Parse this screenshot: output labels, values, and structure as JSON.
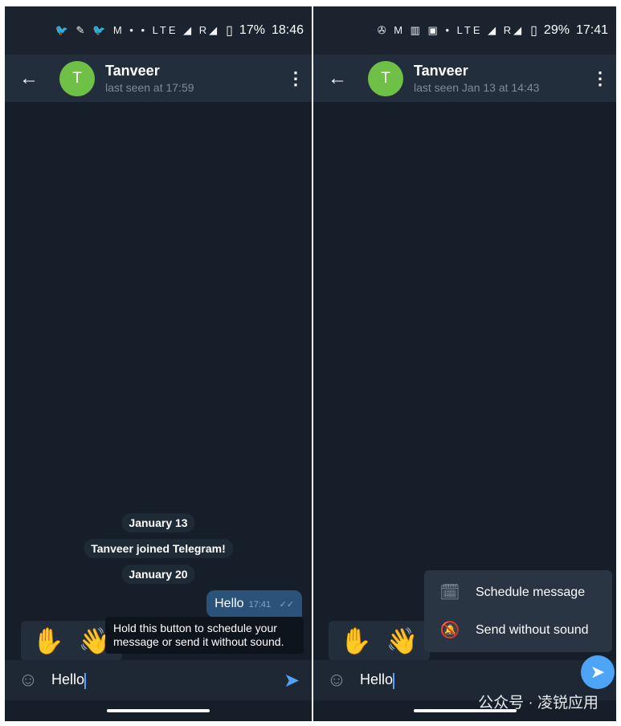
{
  "left": {
    "status": {
      "icons": "🐦 ✎ 🐦 M • • LTE ◢ R◢",
      "battery": "17%",
      "time": "18:46"
    },
    "header": {
      "name": "Tanveer",
      "subtitle": "last seen at 17:59",
      "avatar_letter": "T"
    },
    "messages": {
      "date1": "January 13",
      "service": "Tanveer joined Telegram!",
      "date2": "January 20",
      "bubble_text": "Hello",
      "bubble_time": "17:41",
      "bubble_check": "✓✓"
    },
    "emojis": [
      "✋",
      "👋"
    ],
    "tooltip": "Hold this button to schedule your message or send it without sound.",
    "input": {
      "value": "Hello"
    }
  },
  "right": {
    "status": {
      "icons": "✇ M ▥ ▣ • LTE ◢ R◢",
      "battery": "29%",
      "time": "17:41"
    },
    "header": {
      "name": "Tanveer",
      "subtitle": "last seen Jan 13 at 14:43",
      "avatar_letter": "T"
    },
    "emojis": [
      "✋",
      "👋"
    ],
    "menu": [
      {
        "label": "Schedule message",
        "icon": "calendar-icon"
      },
      {
        "label": "Send without sound",
        "icon": "bell-off-icon"
      }
    ],
    "input": {
      "value": "Hello"
    },
    "watermark": "公众号 · 凌锐应用"
  },
  "colors": {
    "accent": "#4ea4f6",
    "bubble": "#2b5278",
    "avatar": "#6fc046"
  }
}
